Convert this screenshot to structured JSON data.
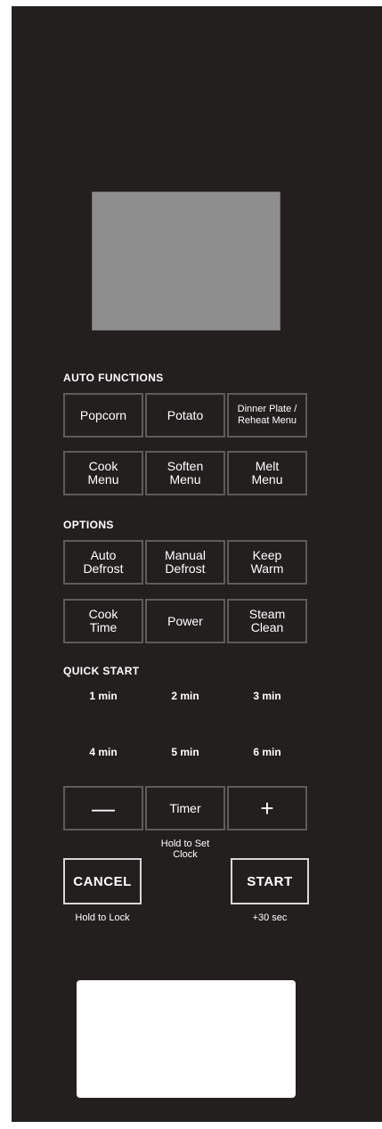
{
  "sections": {
    "auto_functions": "AUTO FUNCTIONS",
    "options": "OPTIONS",
    "quick_start": "QUICK START"
  },
  "auto_functions": {
    "popcorn": "Popcorn",
    "potato": "Potato",
    "dinner_plate": "Dinner Plate /\nReheat Menu",
    "cook_menu": "Cook\nMenu",
    "soften_menu": "Soften\nMenu",
    "melt_menu": "Melt\nMenu"
  },
  "options": {
    "auto_defrost": "Auto\nDefrost",
    "manual_defrost": "Manual\nDefrost",
    "keep_warm": "Keep\nWarm",
    "cook_time": "Cook\nTime",
    "power": "Power",
    "steam_clean": "Steam\nClean"
  },
  "quick_start": [
    "1 min",
    "2 min",
    "3 min",
    "4 min",
    "5 min",
    "6 min"
  ],
  "controls": {
    "minus": "—",
    "timer": "Timer",
    "plus": "+",
    "timer_hint": "Hold to Set\nClock",
    "cancel": "CANCEL",
    "cancel_hint": "Hold to Lock",
    "start": "START",
    "start_hint": "+30 sec"
  },
  "colors": {
    "panel": "#231f1f",
    "display": "#8e8e8e",
    "button_border": "#5f5b5b",
    "text": "#ffffff"
  }
}
